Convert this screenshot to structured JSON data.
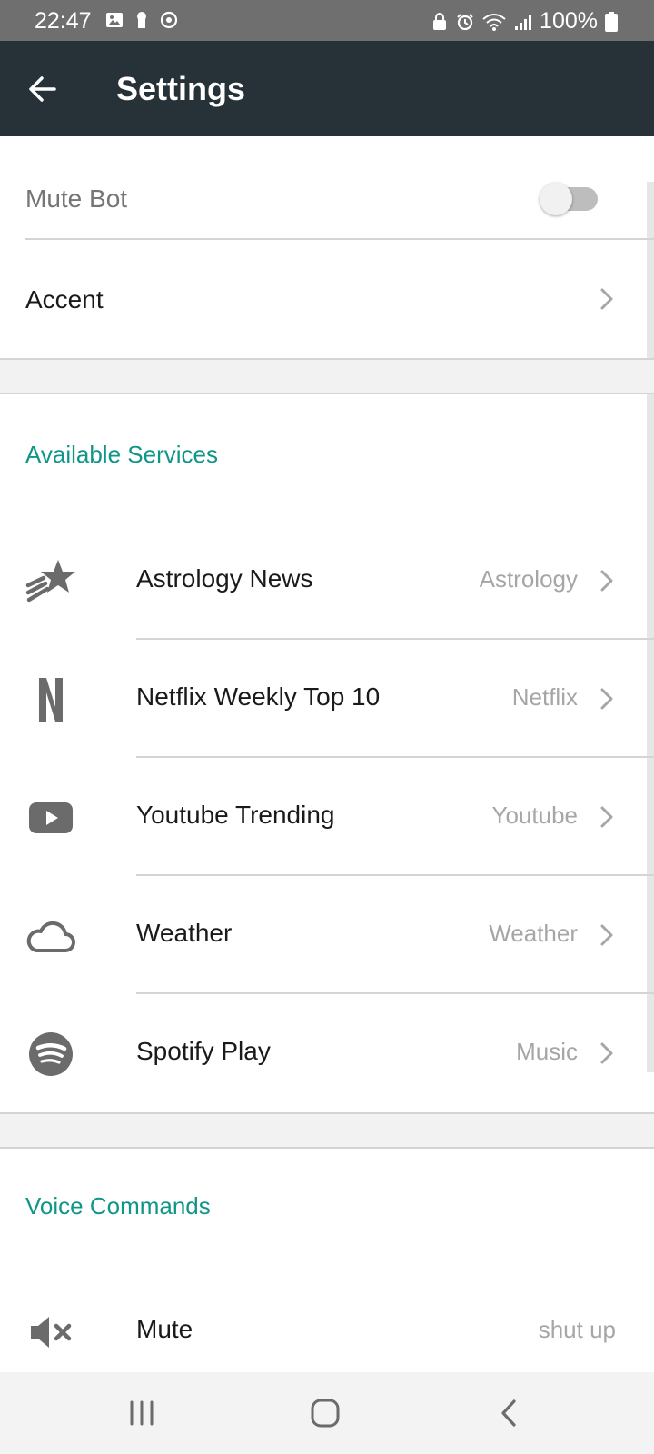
{
  "status_bar": {
    "time": "22:47",
    "battery": "100%"
  },
  "app_bar": {
    "title": "Settings"
  },
  "settings": {
    "mute_bot": {
      "label": "Mute Bot",
      "enabled": false
    },
    "accent": {
      "label": "Accent"
    }
  },
  "available_services": {
    "header": "Available Services",
    "items": [
      {
        "title": "Astrology News",
        "category": "Astrology",
        "icon": "shooting-star-icon"
      },
      {
        "title": "Netflix Weekly Top 10",
        "category": "Netflix",
        "icon": "netflix-icon"
      },
      {
        "title": "Youtube Trending",
        "category": "Youtube",
        "icon": "youtube-icon"
      },
      {
        "title": "Weather",
        "category": "Weather",
        "icon": "cloud-icon"
      },
      {
        "title": "Spotify Play",
        "category": "Music",
        "icon": "spotify-icon"
      }
    ]
  },
  "voice_commands": {
    "header": "Voice Commands",
    "items": [
      {
        "title": "Mute",
        "phrase": "shut up",
        "icon": "volume-mute-icon"
      }
    ]
  },
  "colors": {
    "app_bar": "#263238",
    "accent_teal": "#109688",
    "icon_gray": "#6b6b6b"
  }
}
